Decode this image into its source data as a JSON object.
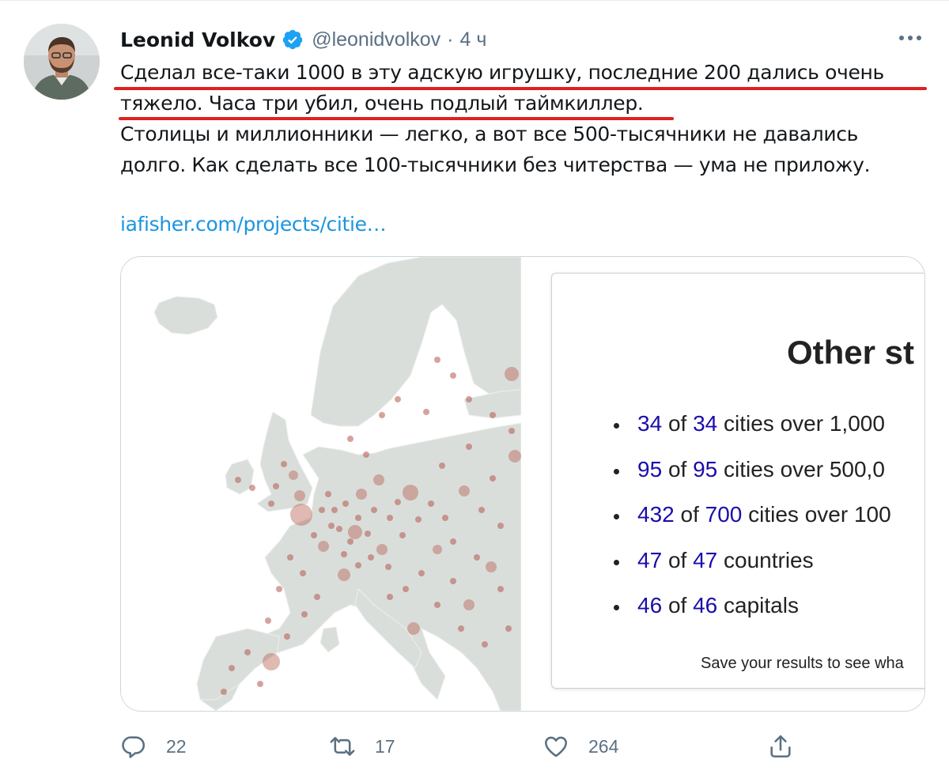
{
  "tweet": {
    "author_name": "Leonid Volkov",
    "handle": "@leonidvolkov",
    "separator": "·",
    "time": "4 ч",
    "text_lines": [
      "Сделал все-таки 1000 в эту адскую игрушку, последние 200 дались очень",
      "тяжело. Часа три убил, очень подлый таймкиллер.",
      "Столицы и миллионники — легко, а вот все 500-тысячники не давались",
      "долго. Как сделать все 100-тысячники без читерства — ума не приложу."
    ],
    "link_text": "iafisher.com/projects/citie…",
    "icons": {
      "verified": "verified-badge-icon",
      "more": "more-options-icon",
      "reply": "reply-icon",
      "retweet": "retweet-icon",
      "like": "like-icon",
      "share": "share-icon"
    },
    "colors": {
      "link": "#1b95e0",
      "verified": "#1da1f2",
      "highlight_underline": "#e02020",
      "stat_numbers": "#1a0dab",
      "map_land": "#d9dedb",
      "city_dots": "#b5574a"
    }
  },
  "card": {
    "title": "Other st",
    "stats": [
      {
        "found": "34",
        "of": "of",
        "total": "34",
        "label": "cities over 1,000"
      },
      {
        "found": "95",
        "of": "of",
        "total": "95",
        "label": "cities over 500,0"
      },
      {
        "found": "432",
        "of": "of",
        "total": "700",
        "label": "cities over 100"
      },
      {
        "found": "47",
        "of": "of",
        "total": "47",
        "label": "countries"
      },
      {
        "found": "46",
        "of": "of",
        "total": "46",
        "label": "capitals"
      }
    ],
    "footer_note": "Save your results to see wha"
  },
  "actions": {
    "reply_count": "22",
    "retweet_count": "17",
    "like_count": "264",
    "share_count": ""
  }
}
